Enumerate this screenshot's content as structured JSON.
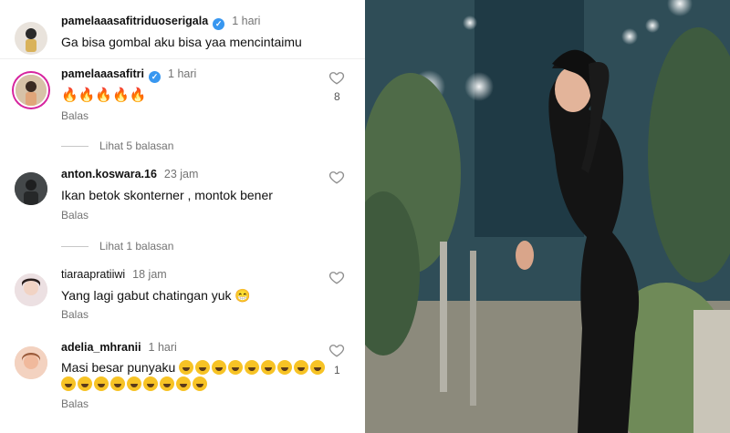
{
  "comments": [
    {
      "username": "pamelaaasafitriduoserigala",
      "verified": true,
      "time": "1 hari",
      "text": "Ga bisa gombal aku bisa yaa mencintaimu",
      "reply_label": "",
      "likes": ""
    },
    {
      "username": "pamelaaasafitri",
      "verified": true,
      "time": "1 hari",
      "text": "🔥🔥🔥🔥🔥",
      "reply_label": "Balas",
      "likes": "8"
    },
    {
      "username": "anton.koswara.16",
      "verified": false,
      "time": "23 jam",
      "text": "Ikan betok skonterner , montok bener",
      "reply_label": "Balas",
      "likes": ""
    },
    {
      "username": "tiaraapratiiwi",
      "verified": false,
      "time": "18 jam",
      "text": "Yang lagi gabut chatingan yuk 😁",
      "reply_label": "Balas",
      "likes": ""
    },
    {
      "username": "adelia_mhranii",
      "verified": false,
      "time": "1 hari",
      "text_line1": "Masi besar punyaku",
      "reply_label": "Balas",
      "likes": "1"
    }
  ],
  "view_replies": [
    "Lihat 5 balasan",
    "Lihat 1 balasan"
  ],
  "icons": {
    "verified": "verified-badge-icon",
    "like": "heart-outline-icon",
    "laugh": "rolling-on-floor-laughing-emoji"
  },
  "colors": {
    "verified": "#3897f0",
    "secondary_text": "#737373"
  }
}
